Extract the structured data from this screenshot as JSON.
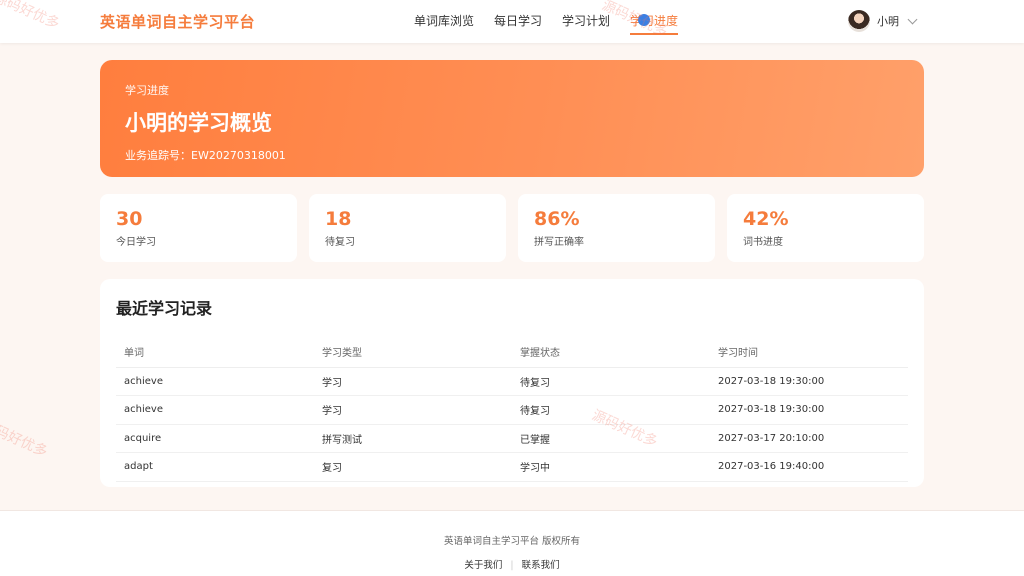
{
  "brand": "英语单词自主学习平台",
  "nav": [
    {
      "label": "单词库浏览",
      "active": false
    },
    {
      "label": "每日学习",
      "active": false
    },
    {
      "label": "学习计划",
      "active": false
    },
    {
      "label": "学习进度",
      "active": true
    }
  ],
  "user": {
    "name": "小明"
  },
  "hero": {
    "subtitle": "学习进度",
    "title": "小明的学习概览",
    "tracking": "业务追踪号：EW20270318001"
  },
  "stats": [
    {
      "value": "30",
      "label": "今日学习"
    },
    {
      "value": "18",
      "label": "待复习"
    },
    {
      "value": "86%",
      "label": "拼写正确率"
    },
    {
      "value": "42%",
      "label": "词书进度"
    }
  ],
  "records": {
    "title": "最近学习记录",
    "headers": [
      "单词",
      "学习类型",
      "掌握状态",
      "学习时间"
    ],
    "rows": [
      [
        "achieve",
        "学习",
        "待复习",
        "2027-03-18 19:30:00"
      ],
      [
        "achieve",
        "学习",
        "待复习",
        "2027-03-18 19:30:00"
      ],
      [
        "acquire",
        "拼写测试",
        "已掌握",
        "2027-03-17 20:10:00"
      ],
      [
        "adapt",
        "复习",
        "学习中",
        "2027-03-16 19:40:00"
      ]
    ]
  },
  "footer": {
    "copyright": "英语单词自主学习平台 版权所有",
    "links": [
      "关于我们",
      "联系我们"
    ]
  },
  "watermark": "源码好优多",
  "colors": {
    "accent": "#f57c3c",
    "hero_start": "#ff7e3e",
    "hero_end": "#ffa06a"
  }
}
